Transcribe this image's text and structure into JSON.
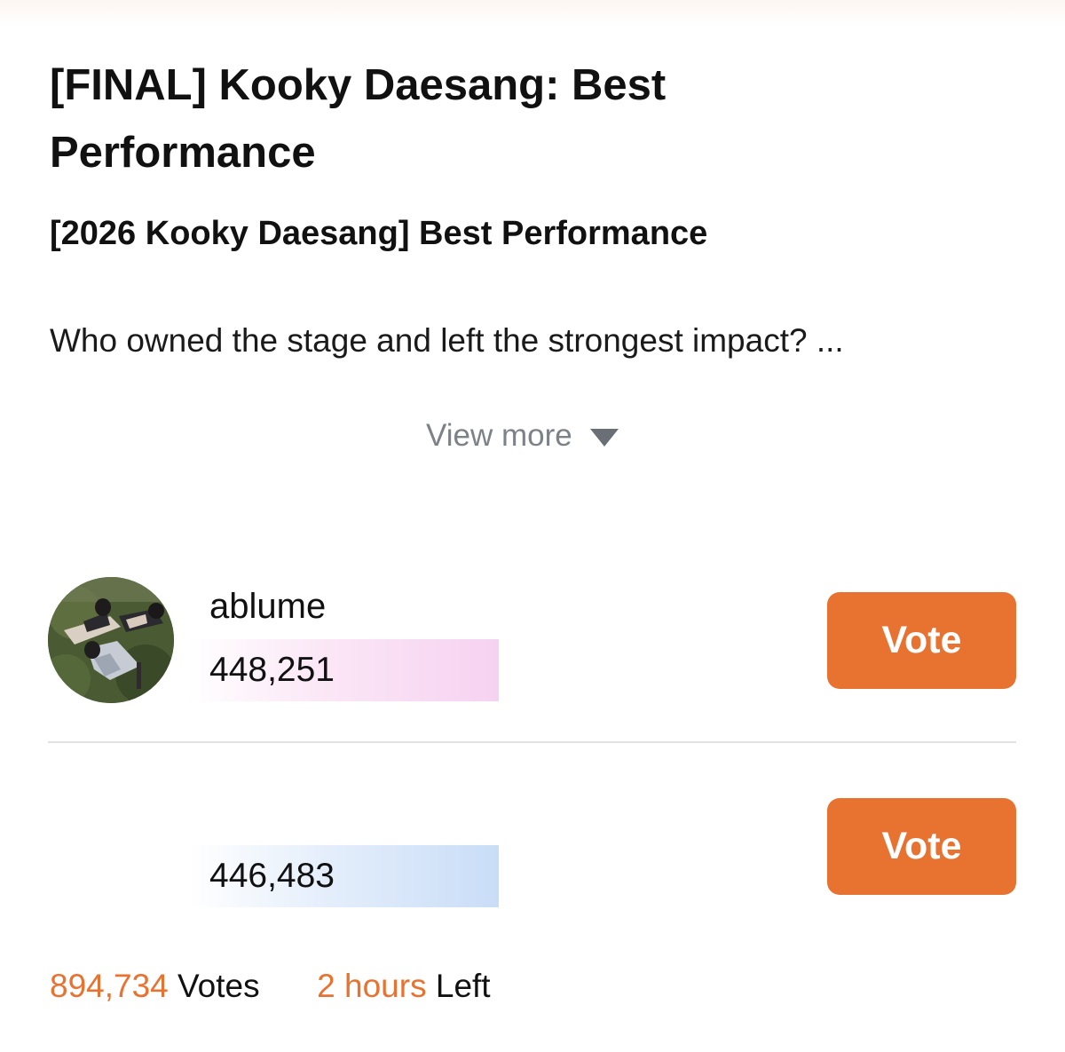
{
  "page": {
    "title": "[FINAL] Kooky Daesang: Best Performance",
    "subtitle": "[2026 Kooky Daesang] Best Performance",
    "description": "Who owned the stage and left the strongest impact? ...",
    "view_more": "View more"
  },
  "candidates": [
    {
      "name": "ablume",
      "votes": "448,251",
      "vote_label": "Vote",
      "bar_color": "#f6d2f1"
    },
    {
      "name": "",
      "votes": "446,483",
      "vote_label": "Vote",
      "bar_color": "#c9ddf7"
    }
  ],
  "footer": {
    "total_votes": "894,734",
    "votes_label": "Votes",
    "time_left": "2 hours",
    "left_label": "Left"
  },
  "colors": {
    "accent": "#e87330",
    "muted": "#7d8188",
    "divider": "#e2e2e2"
  },
  "icons": {
    "view_more": "triangle-down-icon"
  }
}
